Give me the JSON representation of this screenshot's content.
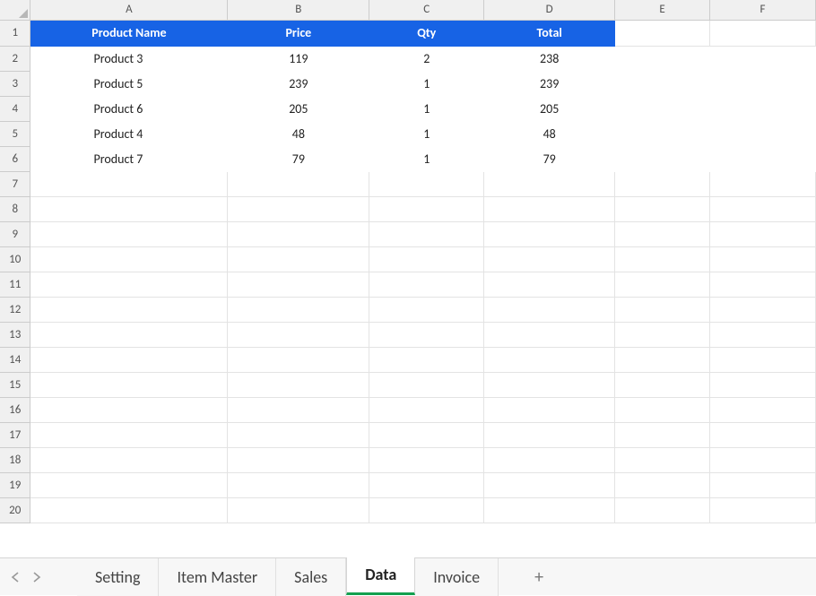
{
  "columns": {
    "A": "A",
    "B": "B",
    "C": "C",
    "D": "D",
    "E": "E",
    "F": "F"
  },
  "row_headers": {
    "r1": "1",
    "r2": "2",
    "r3": "3",
    "r4": "4",
    "r5": "5",
    "r6": "6",
    "r7": "7",
    "r8": "8",
    "r9": "9",
    "r10": "10",
    "r11": "11",
    "r12": "12",
    "r13": "13",
    "r14": "14",
    "r15": "15",
    "r16": "16",
    "r17": "17",
    "r18": "18",
    "r19": "19",
    "r20": "20"
  },
  "table_headers": {
    "product_name": "Product Name",
    "price": "Price",
    "qty": "Qty",
    "total": "Total"
  },
  "rows": [
    {
      "name": "Product 3",
      "price": "119",
      "qty": "2",
      "total": "238"
    },
    {
      "name": "Product 5",
      "price": "239",
      "qty": "1",
      "total": "239"
    },
    {
      "name": "Product 6",
      "price": "205",
      "qty": "1",
      "total": "205"
    },
    {
      "name": "Product 4",
      "price": "48",
      "qty": "1",
      "total": "48"
    },
    {
      "name": "Product 7",
      "price": "79",
      "qty": "1",
      "total": "79"
    }
  ],
  "tabs": {
    "setting": "Setting",
    "item_master": "Item Master",
    "sales": "Sales",
    "data": "Data",
    "invoice": "Invoice"
  },
  "icons": {
    "add_tab": "+"
  }
}
